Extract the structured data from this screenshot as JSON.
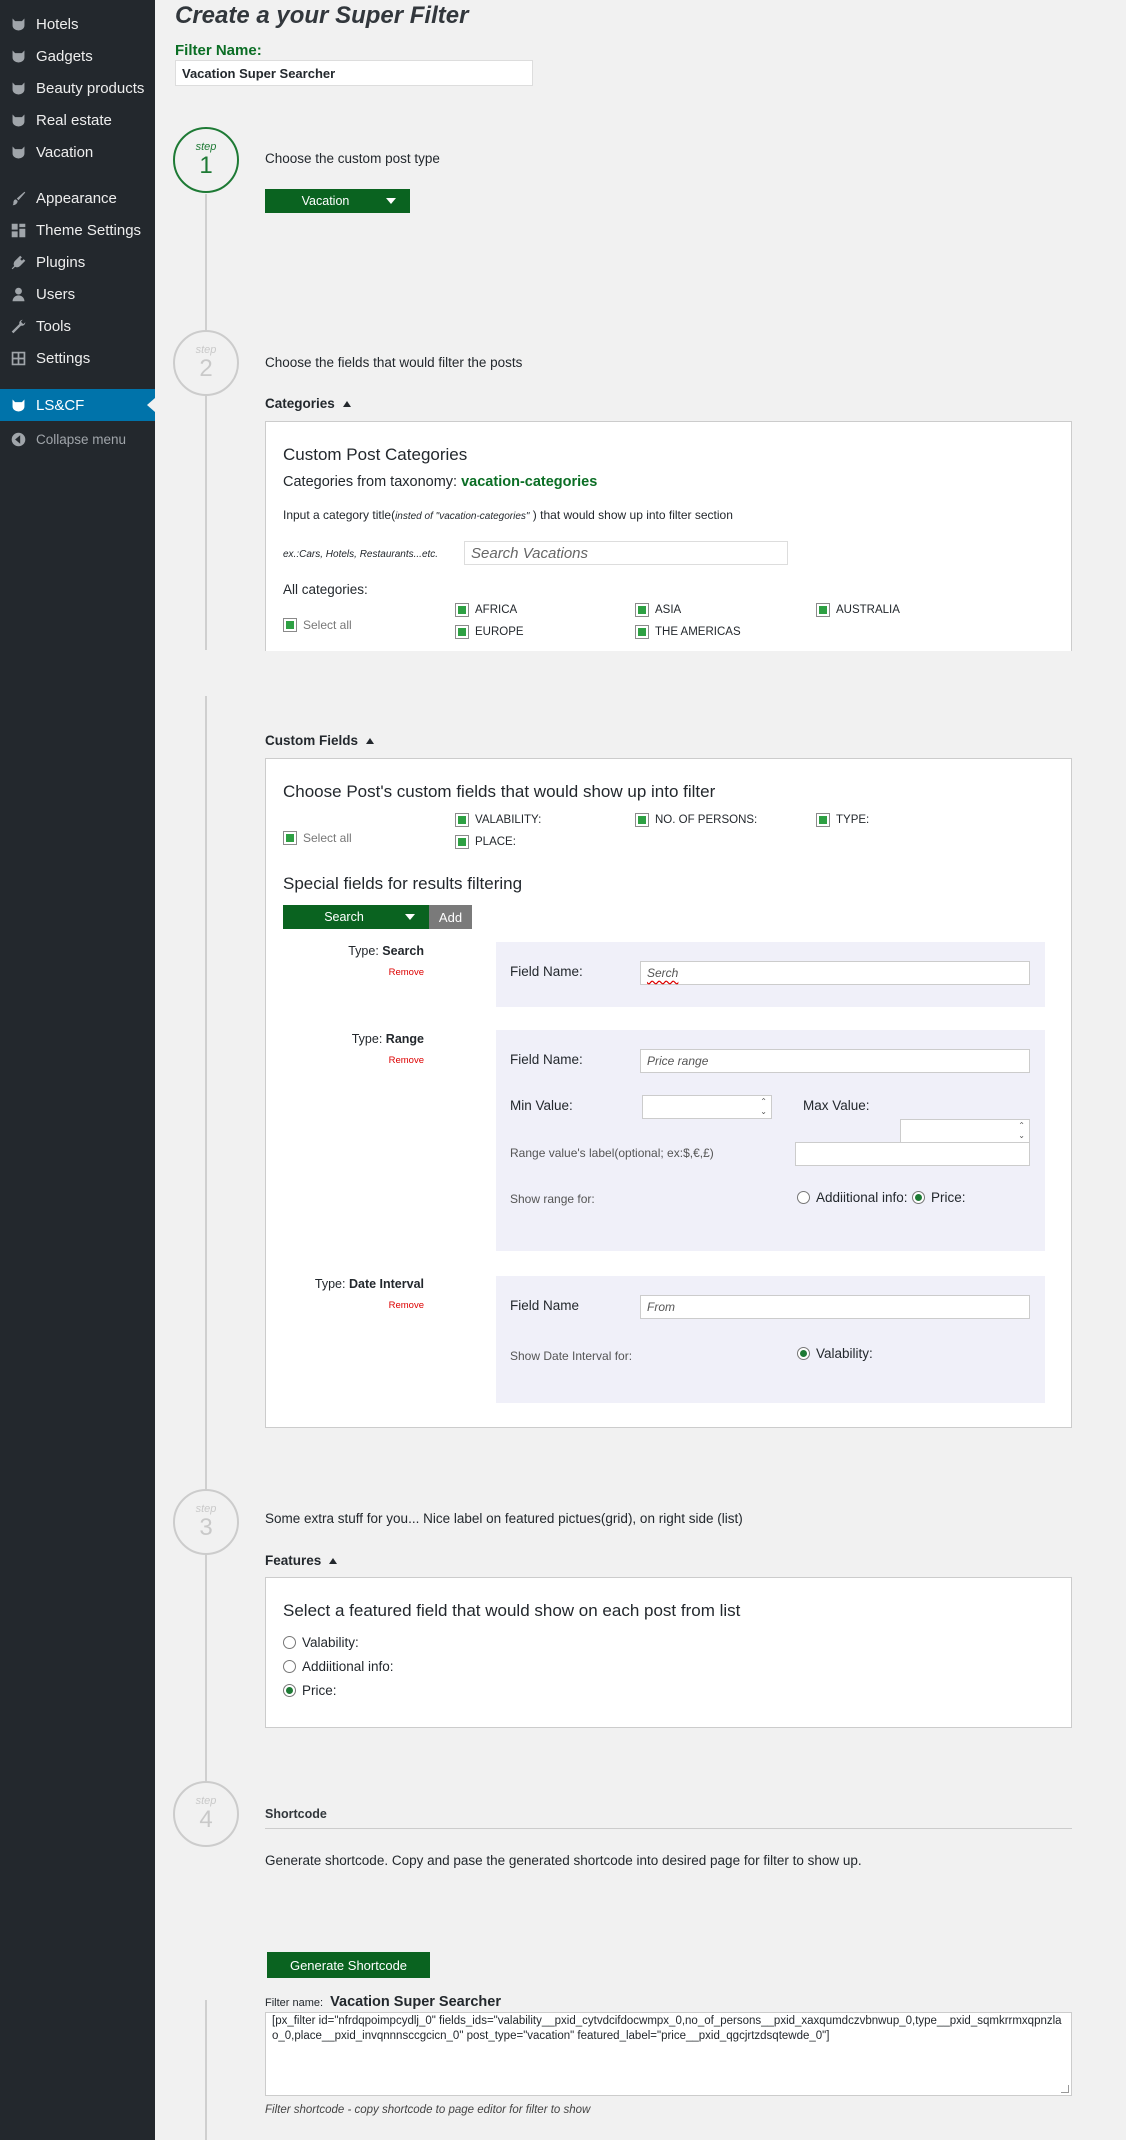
{
  "sidebar": {
    "items": [
      {
        "label": "Hotels",
        "icon": "cat-icon"
      },
      {
        "label": "Gadgets",
        "icon": "cat-icon"
      },
      {
        "label": "Beauty products",
        "icon": "cat-icon"
      },
      {
        "label": "Real estate",
        "icon": "cat-icon"
      },
      {
        "label": "Vacation",
        "icon": "cat-icon"
      },
      {
        "label": "Appearance",
        "icon": "brush-icon"
      },
      {
        "label": "Theme Settings",
        "icon": "grid-icon"
      },
      {
        "label": "Plugins",
        "icon": "plug-icon"
      },
      {
        "label": "Users",
        "icon": "user-icon"
      },
      {
        "label": "Tools",
        "icon": "wrench-icon"
      },
      {
        "label": "Settings",
        "icon": "settings-icon"
      },
      {
        "label": "LS&CF",
        "icon": "cat-icon"
      }
    ],
    "collapse_label": "Collapse menu",
    "active_color": "#0073aa"
  },
  "page": {
    "title": "Create a your Super Filter",
    "filter_name_label": "Filter Name:",
    "filter_name_value": "Vacation Super Searcher"
  },
  "steps": {
    "word": "step",
    "numbers": [
      "1",
      "2",
      "3",
      "4"
    ]
  },
  "step1": {
    "text": "Choose the custom post type",
    "post_type": "Vacation"
  },
  "step2": {
    "text": "Choose the fields that would filter the posts",
    "categories_head": "Categories",
    "cat_panel_title": "Custom Post Categories",
    "taxonomy_prefix": "Categories from taxonomy:",
    "taxonomy_name": "vacation-categories",
    "input_hint_a": "Input a category title(",
    "input_hint_italic": "insted of \"vacation-categories\"",
    "input_hint_b": "  ) that would show up into filter section",
    "example": "ex.:Cars, Hotels, Restaurants...etc.",
    "search_value": "Search Vacations",
    "all_categories": "All categories:",
    "select_all": "Select all",
    "categories": [
      "AFRICA",
      "ASIA",
      "AUSTRALIA",
      "EUROPE",
      "THE AMERICAS"
    ],
    "custom_fields_head": "Custom Fields",
    "cf_title": "Choose Post's custom fields that would show up into filter",
    "custom_fields": [
      "VALABILITY:",
      "NO. OF PERSONS:",
      "TYPE:",
      "PLACE:"
    ],
    "special_title": "Special fields for results filtering",
    "special_select": "Search",
    "add_label": "Add",
    "type_prefix": "Type:",
    "remove_label": "Remove",
    "type_search": "Search",
    "type_range": "Range",
    "type_date": "Date Interval",
    "field_name_label": "Field Name:",
    "field_name_label_nc": "Field Name",
    "search_field_value": "Serch",
    "range_field_value": "Price range",
    "min_label": "Min Value:",
    "max_label": "Max Value:",
    "range_label_text": "Range value's label(optional; ex:$,€,£)",
    "show_range_for": "Show range for:",
    "range_opt_additional": "Addiitional info:",
    "range_opt_price": "Price:",
    "date_field_value": "From",
    "show_date_for": "Show Date Interval for:",
    "date_opt_valability": "Valability:"
  },
  "step3": {
    "text": "Some extra stuff for you... Nice label on featured pictues(grid), on right side (list)",
    "features_head": "Features",
    "panel_title": "Select a featured field that would show on each post from list",
    "options": [
      "Valability:",
      "Addiitional info:",
      "Price:"
    ],
    "selected_index": 2
  },
  "step4": {
    "shortcode_head": "Shortcode",
    "text": "Generate shortcode. Copy and pase the generated shortcode into desired page for filter to show up.",
    "generate_label": "Generate Shortcode",
    "filter_name_small": "Filter name:",
    "filter_name_value": "Vacation Super Searcher",
    "code": "[px_filter id=\"nfrdqpoimpcydlj_0\" fields_ids=\"valability__pxid_cytvdcifdocwmpx_0,no_of_persons__pxid_xaxqumdczvbnwup_0,type__pxid_sqmkrrmxqpnzlao_0,place__pxid_invqnnnsccgcicn_0\" post_type=\"vacation\" featured_label=\"price__pxid_qgcjrtzdsqtewde_0\"]",
    "note": "Filter shortcode - copy shortcode to page editor for filter to show"
  },
  "colors": {
    "brand_green": "#0a6320",
    "label_green": "#0b6e25",
    "remove_red": "#dd0000",
    "sidebar_bg": "#23282d"
  }
}
